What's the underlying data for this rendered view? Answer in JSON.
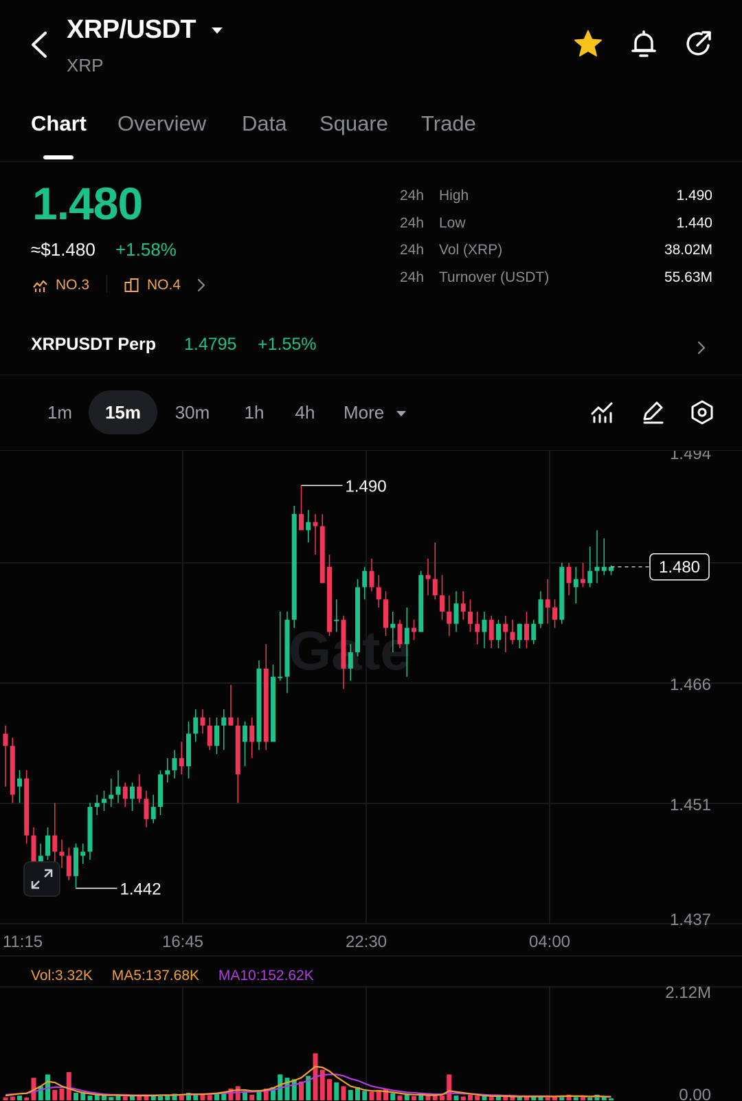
{
  "header": {
    "title": "XRP/USDT",
    "subtitle": "XRP",
    "icons": [
      "back-icon",
      "caret-down-icon",
      "star-icon",
      "bell-icon",
      "share-icon"
    ],
    "favorite_color": "#f6c21b"
  },
  "tabs": [
    {
      "label": "Chart",
      "active": true
    },
    {
      "label": "Overview",
      "active": false
    },
    {
      "label": "Data",
      "active": false
    },
    {
      "label": "Square",
      "active": false
    },
    {
      "label": "Trade",
      "active": false
    }
  ],
  "ticker": {
    "price": "1.480",
    "usd_price": "≈$1.480",
    "change": "+1.58%",
    "rank1": "NO.3",
    "rank2": "NO.4",
    "up_color": "#1cc28a",
    "down_color": "#f0375a"
  },
  "stats": [
    {
      "period": "24h",
      "label": "High",
      "value": "1.490"
    },
    {
      "period": "24h",
      "label": "Low",
      "value": "1.440"
    },
    {
      "period": "24h",
      "label": "Vol (XRP)",
      "value": "38.02M"
    },
    {
      "period": "24h",
      "label": "Turnover (USDT)",
      "value": "55.63M"
    }
  ],
  "perp": {
    "name": "XRPUSDT Perp",
    "price": "1.4795",
    "change": "+1.55%"
  },
  "intervals": {
    "options": [
      "1m",
      "15m",
      "30m",
      "1h",
      "4h"
    ],
    "selected": "15m",
    "more_label": "More"
  },
  "chart_data": {
    "type": "candlestick",
    "interval": "15m",
    "watermark": "Gate",
    "y_ticks": [
      "1.494",
      "1.466",
      "1.451",
      "1.437"
    ],
    "x_ticks": [
      "11:15",
      "16:45",
      "22:30",
      "04:00"
    ],
    "high_label": "1.490",
    "low_label": "1.442",
    "last_price_label": "1.480",
    "ylim": [
      1.437,
      1.494
    ],
    "candles": [
      {
        "o": 1.4595,
        "h": 1.4605,
        "l": 1.453,
        "c": 1.458
      },
      {
        "o": 1.458,
        "h": 1.459,
        "l": 1.451,
        "c": 1.452
      },
      {
        "o": 1.453,
        "h": 1.455,
        "l": 1.451,
        "c": 1.454
      },
      {
        "o": 1.454,
        "h": 1.455,
        "l": 1.446,
        "c": 1.447
      },
      {
        "o": 1.447,
        "h": 1.448,
        "l": 1.441,
        "c": 1.4425
      },
      {
        "o": 1.4425,
        "h": 1.446,
        "l": 1.4415,
        "c": 1.4445
      },
      {
        "o": 1.4445,
        "h": 1.448,
        "l": 1.444,
        "c": 1.447
      },
      {
        "o": 1.447,
        "h": 1.451,
        "l": 1.443,
        "c": 1.445
      },
      {
        "o": 1.445,
        "h": 1.4465,
        "l": 1.443,
        "c": 1.4445
      },
      {
        "o": 1.4445,
        "h": 1.4455,
        "l": 1.4415,
        "c": 1.442
      },
      {
        "o": 1.442,
        "h": 1.446,
        "l": 1.4405,
        "c": 1.4455
      },
      {
        "o": 1.4445,
        "h": 1.446,
        "l": 1.4435,
        "c": 1.445
      },
      {
        "o": 1.445,
        "h": 1.451,
        "l": 1.444,
        "c": 1.4505
      },
      {
        "o": 1.4505,
        "h": 1.452,
        "l": 1.4495,
        "c": 1.451
      },
      {
        "o": 1.451,
        "h": 1.4525,
        "l": 1.45,
        "c": 1.4515
      },
      {
        "o": 1.4515,
        "h": 1.454,
        "l": 1.4505,
        "c": 1.452
      },
      {
        "o": 1.452,
        "h": 1.455,
        "l": 1.451,
        "c": 1.453
      },
      {
        "o": 1.453,
        "h": 1.4535,
        "l": 1.4505,
        "c": 1.4515
      },
      {
        "o": 1.4515,
        "h": 1.4535,
        "l": 1.45,
        "c": 1.453
      },
      {
        "o": 1.453,
        "h": 1.4545,
        "l": 1.451,
        "c": 1.4515
      },
      {
        "o": 1.4515,
        "h": 1.4525,
        "l": 1.448,
        "c": 1.449
      },
      {
        "o": 1.449,
        "h": 1.452,
        "l": 1.4485,
        "c": 1.4505
      },
      {
        "o": 1.4505,
        "h": 1.455,
        "l": 1.4495,
        "c": 1.4545
      },
      {
        "o": 1.4545,
        "h": 1.4565,
        "l": 1.4535,
        "c": 1.455
      },
      {
        "o": 1.455,
        "h": 1.4575,
        "l": 1.454,
        "c": 1.4565
      },
      {
        "o": 1.4565,
        "h": 1.4585,
        "l": 1.4545,
        "c": 1.4555
      },
      {
        "o": 1.4555,
        "h": 1.461,
        "l": 1.454,
        "c": 1.4595
      },
      {
        "o": 1.4595,
        "h": 1.4625,
        "l": 1.4585,
        "c": 1.4615
      },
      {
        "o": 1.4615,
        "h": 1.4625,
        "l": 1.4595,
        "c": 1.4605
      },
      {
        "o": 1.4605,
        "h": 1.4615,
        "l": 1.4575,
        "c": 1.458
      },
      {
        "o": 1.458,
        "h": 1.4615,
        "l": 1.457,
        "c": 1.4605
      },
      {
        "o": 1.4605,
        "h": 1.4625,
        "l": 1.4575,
        "c": 1.4615
      },
      {
        "o": 1.4615,
        "h": 1.4655,
        "l": 1.4605,
        "c": 1.4605
      },
      {
        "o": 1.4605,
        "h": 1.4615,
        "l": 1.451,
        "c": 1.4545
      },
      {
        "o": 1.4585,
        "h": 1.461,
        "l": 1.4555,
        "c": 1.4605
      },
      {
        "o": 1.4605,
        "h": 1.4615,
        "l": 1.4565,
        "c": 1.4585
      },
      {
        "o": 1.4585,
        "h": 1.4685,
        "l": 1.4575,
        "c": 1.4675
      },
      {
        "o": 1.4675,
        "h": 1.4705,
        "l": 1.4575,
        "c": 1.4585
      },
      {
        "o": 1.4585,
        "h": 1.468,
        "l": 1.4585,
        "c": 1.4665
      },
      {
        "o": 1.4665,
        "h": 1.4745,
        "l": 1.466,
        "c": 1.4665
      },
      {
        "o": 1.4665,
        "h": 1.4745,
        "l": 1.4645,
        "c": 1.4735
      },
      {
        "o": 1.4735,
        "h": 1.4875,
        "l": 1.4725,
        "c": 1.4865
      },
      {
        "o": 1.4865,
        "h": 1.49,
        "l": 1.4845,
        "c": 1.4845
      },
      {
        "o": 1.4845,
        "h": 1.487,
        "l": 1.483,
        "c": 1.4855
      },
      {
        "o": 1.4855,
        "h": 1.4865,
        "l": 1.4815,
        "c": 1.485
      },
      {
        "o": 1.485,
        "h": 1.4865,
        "l": 1.478,
        "c": 1.478
      },
      {
        "o": 1.48,
        "h": 1.4815,
        "l": 1.4715,
        "c": 1.472
      },
      {
        "o": 1.4735,
        "h": 1.476,
        "l": 1.472,
        "c": 1.4735
      },
      {
        "o": 1.4735,
        "h": 1.474,
        "l": 1.465,
        "c": 1.4675
      },
      {
        "o": 1.4675,
        "h": 1.4705,
        "l": 1.466,
        "c": 1.4695
      },
      {
        "o": 1.4695,
        "h": 1.4785,
        "l": 1.469,
        "c": 1.4775
      },
      {
        "o": 1.4775,
        "h": 1.48,
        "l": 1.476,
        "c": 1.4795
      },
      {
        "o": 1.4795,
        "h": 1.481,
        "l": 1.477,
        "c": 1.4775
      },
      {
        "o": 1.4775,
        "h": 1.479,
        "l": 1.475,
        "c": 1.476
      },
      {
        "o": 1.476,
        "h": 1.477,
        "l": 1.4715,
        "c": 1.4725
      },
      {
        "o": 1.4725,
        "h": 1.4745,
        "l": 1.4695,
        "c": 1.473
      },
      {
        "o": 1.473,
        "h": 1.4735,
        "l": 1.47,
        "c": 1.4705
      },
      {
        "o": 1.4705,
        "h": 1.475,
        "l": 1.4665,
        "c": 1.4725
      },
      {
        "o": 1.4725,
        "h": 1.4735,
        "l": 1.471,
        "c": 1.472
      },
      {
        "o": 1.472,
        "h": 1.4795,
        "l": 1.472,
        "c": 1.479
      },
      {
        "o": 1.479,
        "h": 1.481,
        "l": 1.4765,
        "c": 1.4785
      },
      {
        "o": 1.4785,
        "h": 1.483,
        "l": 1.476,
        "c": 1.4765
      },
      {
        "o": 1.4765,
        "h": 1.479,
        "l": 1.4735,
        "c": 1.4745
      },
      {
        "o": 1.4745,
        "h": 1.4765,
        "l": 1.4715,
        "c": 1.473
      },
      {
        "o": 1.473,
        "h": 1.477,
        "l": 1.472,
        "c": 1.4755
      },
      {
        "o": 1.4755,
        "h": 1.477,
        "l": 1.4735,
        "c": 1.4745
      },
      {
        "o": 1.4745,
        "h": 1.476,
        "l": 1.472,
        "c": 1.473
      },
      {
        "o": 1.473,
        "h": 1.4745,
        "l": 1.4705,
        "c": 1.472
      },
      {
        "o": 1.472,
        "h": 1.4745,
        "l": 1.47,
        "c": 1.4735
      },
      {
        "o": 1.4735,
        "h": 1.474,
        "l": 1.47,
        "c": 1.471
      },
      {
        "o": 1.471,
        "h": 1.4735,
        "l": 1.47,
        "c": 1.473
      },
      {
        "o": 1.473,
        "h": 1.474,
        "l": 1.4695,
        "c": 1.472
      },
      {
        "o": 1.472,
        "h": 1.4735,
        "l": 1.4705,
        "c": 1.471
      },
      {
        "o": 1.471,
        "h": 1.473,
        "l": 1.47,
        "c": 1.473
      },
      {
        "o": 1.473,
        "h": 1.4745,
        "l": 1.47,
        "c": 1.471
      },
      {
        "o": 1.471,
        "h": 1.4735,
        "l": 1.4705,
        "c": 1.473
      },
      {
        "o": 1.473,
        "h": 1.477,
        "l": 1.4725,
        "c": 1.476
      },
      {
        "o": 1.476,
        "h": 1.4785,
        "l": 1.473,
        "c": 1.475
      },
      {
        "o": 1.475,
        "h": 1.476,
        "l": 1.4725,
        "c": 1.4735
      },
      {
        "o": 1.4735,
        "h": 1.4805,
        "l": 1.473,
        "c": 1.48
      },
      {
        "o": 1.48,
        "h": 1.4805,
        "l": 1.4765,
        "c": 1.478
      },
      {
        "o": 1.4775,
        "h": 1.48,
        "l": 1.4755,
        "c": 1.4785
      },
      {
        "o": 1.4785,
        "h": 1.4805,
        "l": 1.4775,
        "c": 1.478
      },
      {
        "o": 1.478,
        "h": 1.4825,
        "l": 1.4775,
        "c": 1.4795
      },
      {
        "o": 1.4795,
        "h": 1.4845,
        "l": 1.478,
        "c": 1.48
      },
      {
        "o": 1.4795,
        "h": 1.4835,
        "l": 1.479,
        "c": 1.48
      },
      {
        "o": 1.4795,
        "h": 1.4802,
        "l": 1.479,
        "c": 1.48
      }
    ]
  },
  "volume": {
    "vol_label": "Vol:3.32K",
    "ma5_label": "MA5:137.68K",
    "ma10_label": "MA10:152.62K",
    "max_label": "2.12M",
    "zero_label": "0.00",
    "ma5_color": "#f0a033",
    "ma10_color": "#b43ee0",
    "max": 2.12,
    "values": [
      0.06,
      0.08,
      0.1,
      0.06,
      0.48,
      0.3,
      0.55,
      0.22,
      0.25,
      0.6,
      0.16,
      0.18,
      0.1,
      0.14,
      0.1,
      0.07,
      0.12,
      0.08,
      0.1,
      0.11,
      0.1,
      0.12,
      0.09,
      0.1,
      0.14,
      0.1,
      0.16,
      0.12,
      0.14,
      0.11,
      0.15,
      0.18,
      0.25,
      0.3,
      0.2,
      0.12,
      0.22,
      0.25,
      0.28,
      0.55,
      0.48,
      0.45,
      0.4,
      0.52,
      1.0,
      0.65,
      0.45,
      0.38,
      0.3,
      0.22,
      0.28,
      0.2,
      0.18,
      0.22,
      0.25,
      0.15,
      0.1,
      0.12,
      0.09,
      0.14,
      0.1,
      0.12,
      0.1,
      0.55,
      0.1,
      0.08,
      0.12,
      0.1,
      0.09,
      0.07,
      0.1,
      0.08,
      0.07,
      0.09,
      0.08,
      0.1,
      0.07,
      0.06,
      0.09,
      0.1,
      0.12,
      0.07,
      0.09,
      0.06,
      0.12,
      0.08,
      0.04
    ],
    "ma5": [
      0.1,
      0.12,
      0.14,
      0.15,
      0.22,
      0.3,
      0.4,
      0.38,
      0.3,
      0.25,
      0.2,
      0.16,
      0.14,
      0.12,
      0.11,
      0.11,
      0.11,
      0.1,
      0.1,
      0.1,
      0.1,
      0.1,
      0.11,
      0.11,
      0.11,
      0.12,
      0.13,
      0.13,
      0.13,
      0.14,
      0.15,
      0.17,
      0.2,
      0.22,
      0.22,
      0.2,
      0.2,
      0.22,
      0.26,
      0.33,
      0.38,
      0.42,
      0.48,
      0.6,
      0.72,
      0.7,
      0.62,
      0.5,
      0.4,
      0.3,
      0.26,
      0.22,
      0.2,
      0.2,
      0.19,
      0.17,
      0.15,
      0.13,
      0.12,
      0.12,
      0.11,
      0.11,
      0.12,
      0.2,
      0.18,
      0.16,
      0.14,
      0.12,
      0.1,
      0.09,
      0.09,
      0.09,
      0.08,
      0.08,
      0.08,
      0.08,
      0.08,
      0.08,
      0.08,
      0.09,
      0.09,
      0.09,
      0.09,
      0.08,
      0.09,
      0.08,
      0.07
    ],
    "ma10": [
      0.12,
      0.13,
      0.14,
      0.15,
      0.18,
      0.22,
      0.26,
      0.28,
      0.28,
      0.27,
      0.24,
      0.2,
      0.17,
      0.15,
      0.13,
      0.12,
      0.12,
      0.12,
      0.11,
      0.11,
      0.11,
      0.11,
      0.11,
      0.11,
      0.11,
      0.12,
      0.12,
      0.12,
      0.13,
      0.13,
      0.14,
      0.15,
      0.16,
      0.17,
      0.18,
      0.18,
      0.19,
      0.2,
      0.22,
      0.26,
      0.3,
      0.33,
      0.37,
      0.42,
      0.5,
      0.54,
      0.55,
      0.55,
      0.52,
      0.46,
      0.42,
      0.36,
      0.3,
      0.27,
      0.24,
      0.21,
      0.19,
      0.17,
      0.16,
      0.15,
      0.14,
      0.13,
      0.13,
      0.15,
      0.15,
      0.14,
      0.14,
      0.13,
      0.12,
      0.11,
      0.11,
      0.1,
      0.1,
      0.09,
      0.09,
      0.09,
      0.09,
      0.09,
      0.08,
      0.08,
      0.09,
      0.09,
      0.08,
      0.08,
      0.08,
      0.08,
      0.08
    ]
  }
}
